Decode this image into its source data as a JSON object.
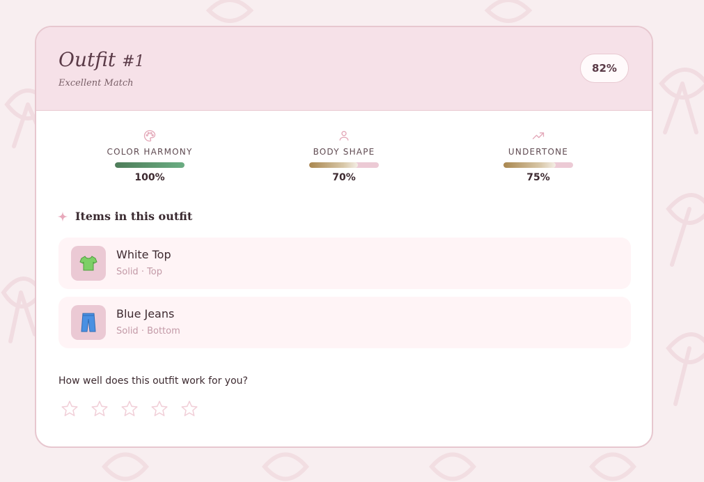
{
  "outfit": {
    "title": "Outfit",
    "number": "#1",
    "subtitle": "Excellent Match",
    "score": "82%"
  },
  "metrics": [
    {
      "label": "COLOR HARMONY",
      "value": "100%",
      "fraction": 1.0,
      "icon": "palette-icon"
    },
    {
      "label": "BODY SHAPE",
      "value": "70%",
      "fraction": 0.7,
      "icon": "person-icon"
    },
    {
      "label": "UNDERTONE",
      "value": "75%",
      "fraction": 0.75,
      "icon": "trending-up-icon"
    }
  ],
  "items_heading": "Items in this outfit",
  "items": [
    {
      "name": "White Top",
      "meta": "Solid · Top",
      "icon": "t-shirt-icon"
    },
    {
      "name": "Blue Jeans",
      "meta": "Solid · Bottom",
      "icon": "jeans-icon"
    }
  ],
  "rating": {
    "question": "How well does this outfit work for you?",
    "stars": 5,
    "value": 0
  },
  "colors": {
    "accent": "#e8a9bb",
    "header_bg": "#f6e1e8",
    "text": "#3d2a30"
  }
}
